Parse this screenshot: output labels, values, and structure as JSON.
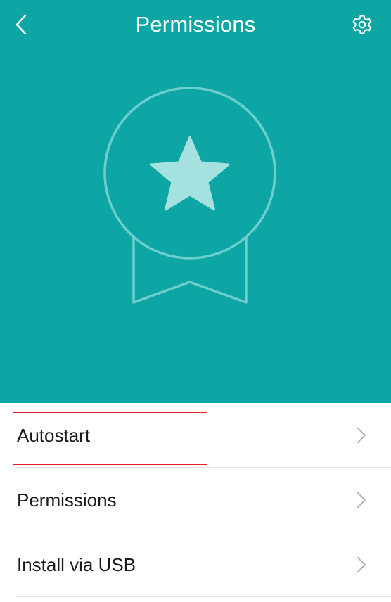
{
  "header": {
    "title": "Permissions",
    "back_icon": "chevron-left-icon",
    "settings_icon": "gear-icon",
    "background_color": "#0da6a5"
  },
  "hero": {
    "emblem_icon": "award-star-badge-icon"
  },
  "list": {
    "items": [
      {
        "label": "Autostart",
        "icon": "chevron-right-icon",
        "highlighted": true
      },
      {
        "label": "Permissions",
        "icon": "chevron-right-icon"
      },
      {
        "label": "Install via USB",
        "icon": "chevron-right-icon"
      }
    ]
  },
  "colors": {
    "accent": "#0da6a5",
    "highlight_border": "#e02020"
  }
}
